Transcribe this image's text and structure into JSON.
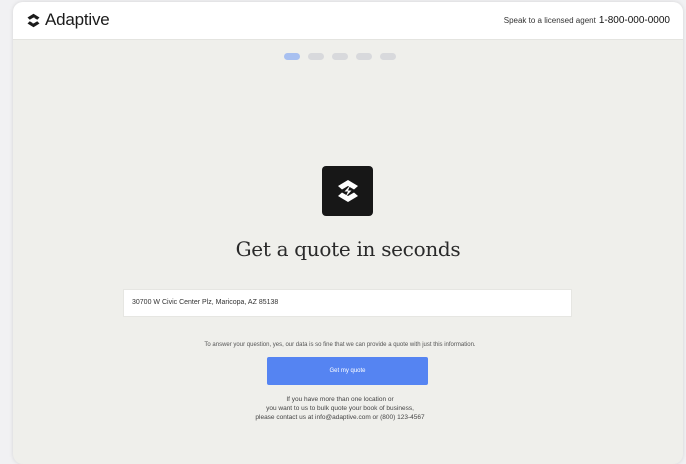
{
  "header": {
    "logo_text": "Adaptive",
    "logo_icon": "adaptive-logo-icon",
    "agent_label": "Speak to a licensed agent",
    "agent_phone": "1-800-000-0000"
  },
  "progress": {
    "total_steps": 5,
    "current_step": 1
  },
  "main": {
    "brand_icon": "adaptive-brand-icon",
    "headline": "Get a quote in seconds",
    "address_value": "30700 W Civic Center Plz, Maricopa, AZ 85138",
    "note": "To answer your question, yes, our data is so fine that we can provide a quote with just this information.",
    "cta_label": "Get my quote",
    "help_line1": "If you have more than one location or",
    "help_line2": "you want to us to bulk quote your book of business,",
    "help_line3": "please contact us at info@adaptive.com or (800) 123-4567"
  },
  "colors": {
    "accent": "#5584f2",
    "background": "#efefeb",
    "tile": "#171717",
    "step_active": "#a8c0f0",
    "step_inactive": "#d8d9dc"
  }
}
